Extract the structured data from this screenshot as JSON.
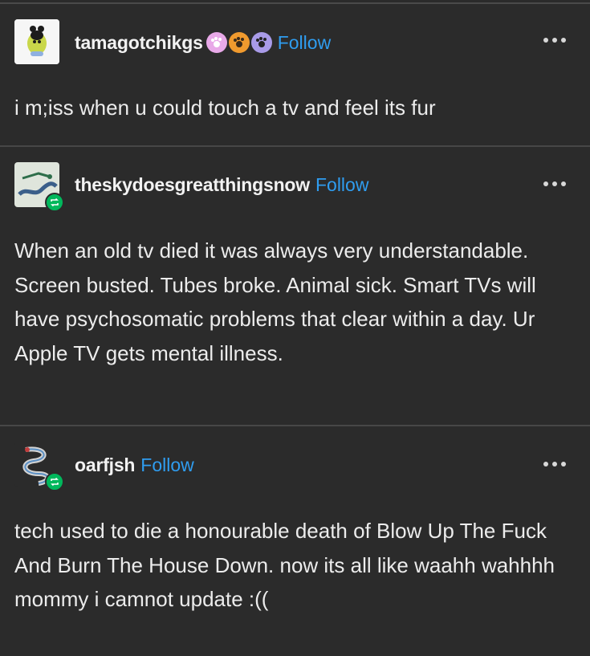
{
  "posts": [
    {
      "username": "tamagotchikgs",
      "follow_label": "Follow",
      "badges": [
        "paw-badge-pink",
        "paw-badge-orange",
        "paw-badge-purple"
      ],
      "text": "i m;iss when u could touch a tv and feel its fur"
    },
    {
      "username": "theskydoesgreatthingsnow",
      "follow_label": "Follow",
      "reblogged": true,
      "text": "When an old tv died it was always very understandable. Screen busted. Tubes broke. Animal sick. Smart TVs will have psychosomatic problems that clear within a day. Ur Apple TV gets mental illness."
    },
    {
      "username": "oarfjsh",
      "follow_label": "Follow",
      "reblogged": true,
      "text": "tech used to die a honourable death of Blow Up The Fuck And Burn The House Down. now its all like waahh wahhhh mommy i camnot update :(("
    }
  ],
  "colors": {
    "background": "#2b2b2b",
    "follow_link": "#2f9df0",
    "reblog_badge": "#00b85c",
    "divider": "#474747"
  }
}
